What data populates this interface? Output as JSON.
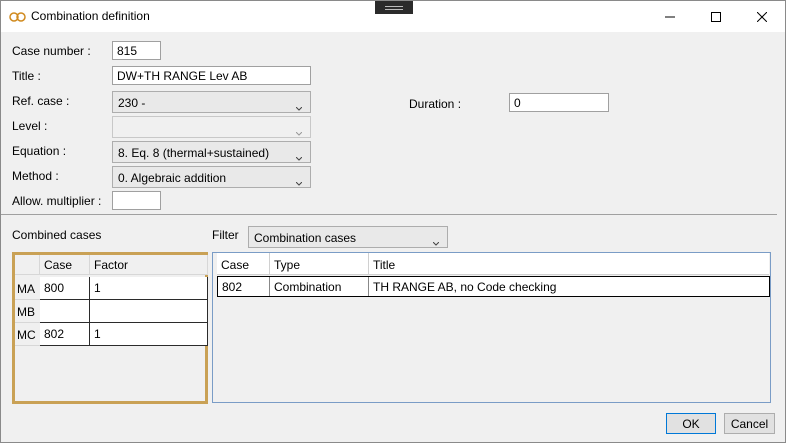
{
  "window": {
    "title": "Combination definition"
  },
  "icons": {
    "app": "link-icon",
    "minimize": "minimize-icon",
    "maximize": "maximize-icon",
    "close": "close-icon",
    "dropdown": "chevron-down-icon"
  },
  "form": {
    "case_number": {
      "label": "Case number :",
      "value": "815"
    },
    "title": {
      "label": "Title :",
      "value": "DW+TH RANGE Lev AB"
    },
    "ref_case": {
      "label": "Ref. case :",
      "value": "230 -"
    },
    "duration": {
      "label": "Duration :",
      "value": "0"
    },
    "level": {
      "label": "Level :",
      "value": ""
    },
    "equation": {
      "label": "Equation :",
      "value": "8. Eq. 8 (thermal+sustained)"
    },
    "method": {
      "label": "Method :",
      "value": "0. Algebraic addition"
    },
    "allow_multiplier": {
      "label": "Allow. multiplier :",
      "value": ""
    }
  },
  "combined": {
    "label": "Combined cases",
    "headers": {
      "case": "Case",
      "factor": "Factor"
    },
    "rows": [
      {
        "name": "MA",
        "case": "800",
        "factor": "1"
      },
      {
        "name": "MB",
        "case": "",
        "factor": ""
      },
      {
        "name": "MC",
        "case": "802",
        "factor": "1"
      }
    ]
  },
  "filter": {
    "label": "Filter",
    "value": "Combination cases",
    "headers": {
      "case": "Case",
      "type": "Type",
      "title": "Title"
    },
    "rows": [
      {
        "case": "802",
        "type": "Combination",
        "title": "TH RANGE AB, no Code checking"
      }
    ]
  },
  "buttons": {
    "ok": "OK",
    "cancel": "Cancel"
  },
  "colors": {
    "highlight_border": "#c9a155",
    "grid_border": "#7a9cc6",
    "default_button_border": "#0078d7"
  }
}
